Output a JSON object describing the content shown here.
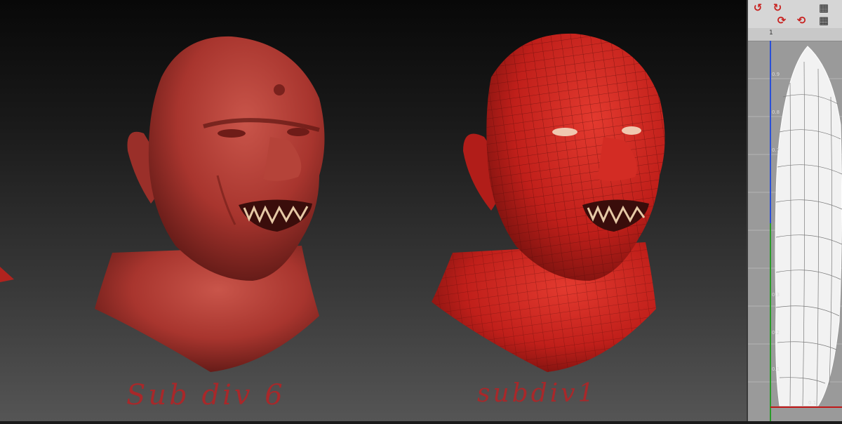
{
  "captions": {
    "left": "Sub div 6",
    "right": "subdiv1"
  },
  "uv_editor": {
    "ruler_value": "1",
    "ticks": [
      "0.9",
      "0.8",
      "0.7",
      "0.3",
      "0.2",
      "0.1",
      "0.1"
    ],
    "toolbar_icons": [
      "rotate-left-icon",
      "rotate-right-icon",
      "checker-icon",
      "checker-icon-2",
      "refresh-icon-a",
      "refresh-icon-b"
    ]
  },
  "colors": {
    "clay": "#b03a33",
    "clay_dark": "#6e1c18",
    "wire_mesh": "#c8211d",
    "caption": "#a8282a",
    "uv_grid_bg": "#9a9a9a"
  }
}
